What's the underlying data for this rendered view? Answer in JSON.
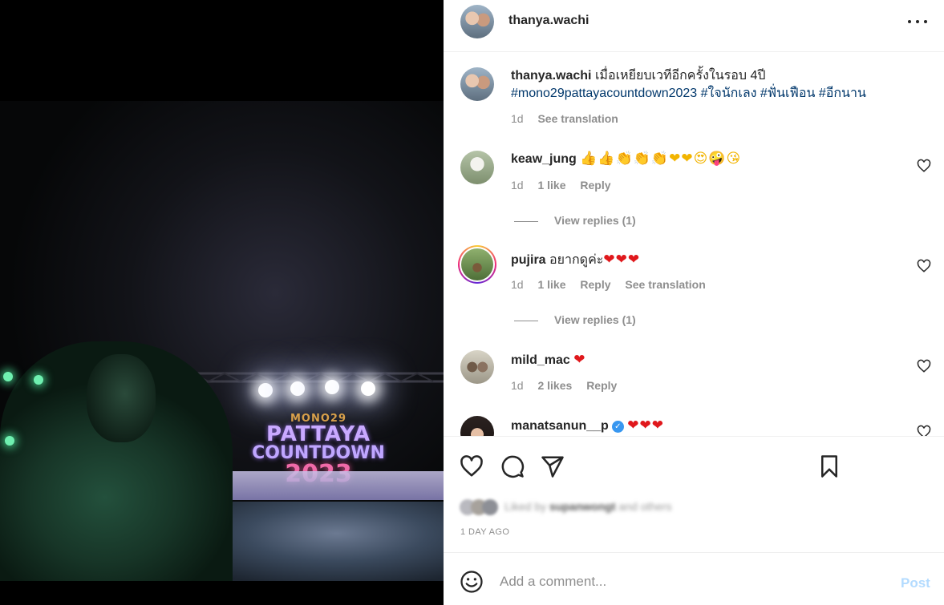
{
  "post": {
    "author": "thanya.wachi",
    "caption": {
      "username": "thanya.wachi",
      "text": "เมื่อเหยียบเวทีอีกครั้งในรอบ 4ปี",
      "hashtags": "#mono29pattayacountdown2023 #ใจนักเลง #ฟั่นเฟือน #อีกนาน",
      "time": "1d",
      "see_translation": "See translation"
    },
    "image": {
      "screen_line1": "MONO29",
      "screen_line2": "PATTAYA",
      "screen_line3": "COUNTDOWN",
      "screen_line4": "2023"
    }
  },
  "comments": [
    {
      "username": "keaw_jung",
      "text": "👍👍👏👏👏❤❤😍🤪😘",
      "time": "1d",
      "likes": "1 like",
      "reply": "Reply",
      "view_replies": "View replies (1)"
    },
    {
      "username": "pujira",
      "text": "อยากดูค่ะ",
      "emoji": "❤❤❤",
      "time": "1d",
      "likes": "1 like",
      "reply": "Reply",
      "see_translation": "See translation",
      "view_replies": "View replies (1)"
    },
    {
      "username": "mild_mac",
      "emoji": "❤",
      "time": "1d",
      "likes": "2 likes",
      "reply": "Reply"
    },
    {
      "username": "manatsanun__p",
      "verified": true,
      "emoji": "❤❤❤"
    }
  ],
  "actions": {
    "liked_by_prefix": "Liked by",
    "liked_by_user": "supanwongt",
    "liked_by_suffix": "and others",
    "time_ago": "1 DAY AGO"
  },
  "add_comment": {
    "placeholder": "Add a comment...",
    "post_label": "Post"
  },
  "icons": {
    "more": "more-options-icon",
    "like": "heart-icon",
    "comment": "comment-icon",
    "share": "share-icon",
    "save": "bookmark-icon",
    "emoji": "emoji-icon"
  },
  "colors": {
    "hashtag": "#00376b",
    "muted": "#8e8e8e",
    "post_button": "#b3dbff",
    "verified": "#3897f0"
  }
}
